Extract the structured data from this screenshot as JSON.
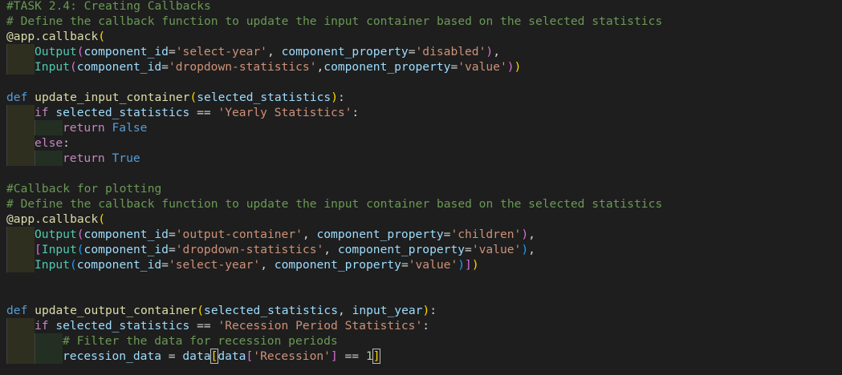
{
  "editor": {
    "lines": [
      {
        "indent": 0,
        "tokens": [
          {
            "t": "#TASK 2.4: Creating Callbacks",
            "c": "comment"
          }
        ]
      },
      {
        "indent": 0,
        "tokens": [
          {
            "t": "# Define the callback function to update the input container based on the selected statistics",
            "c": "comment"
          }
        ]
      },
      {
        "indent": 0,
        "tokens": [
          {
            "t": "@app.",
            "c": "func"
          },
          {
            "t": "callback",
            "c": "func"
          },
          {
            "t": "(",
            "c": "bracket1"
          }
        ]
      },
      {
        "indent": 1,
        "tokens": [
          {
            "t": "Output",
            "c": "cls"
          },
          {
            "t": "(",
            "c": "bracket2"
          },
          {
            "t": "component_id",
            "c": "param"
          },
          {
            "t": "=",
            "c": "op"
          },
          {
            "t": "'select-year'",
            "c": "str"
          },
          {
            "t": ", ",
            "c": "plain"
          },
          {
            "t": "component_property",
            "c": "param"
          },
          {
            "t": "=",
            "c": "op"
          },
          {
            "t": "'disabled'",
            "c": "str"
          },
          {
            "t": ")",
            "c": "bracket2"
          },
          {
            "t": ",",
            "c": "plain"
          }
        ]
      },
      {
        "indent": 1,
        "tokens": [
          {
            "t": "Input",
            "c": "cls"
          },
          {
            "t": "(",
            "c": "bracket2"
          },
          {
            "t": "component_id",
            "c": "param"
          },
          {
            "t": "=",
            "c": "op"
          },
          {
            "t": "'dropdown-statistics'",
            "c": "str"
          },
          {
            "t": ",",
            "c": "plain"
          },
          {
            "t": "component_property",
            "c": "param"
          },
          {
            "t": "=",
            "c": "op"
          },
          {
            "t": "'value'",
            "c": "str"
          },
          {
            "t": ")",
            "c": "bracket2"
          },
          {
            "t": ")",
            "c": "bracket1"
          }
        ]
      },
      {
        "indent": 0,
        "tokens": []
      },
      {
        "indent": 0,
        "tokens": [
          {
            "t": "def ",
            "c": "keyword"
          },
          {
            "t": "update_input_container",
            "c": "func"
          },
          {
            "t": "(",
            "c": "bracket1"
          },
          {
            "t": "selected_statistics",
            "c": "param"
          },
          {
            "t": ")",
            "c": "bracket1"
          },
          {
            "t": ":",
            "c": "plain"
          }
        ]
      },
      {
        "indent": 1,
        "tokens": [
          {
            "t": "if ",
            "c": "control"
          },
          {
            "t": "selected_statistics",
            "c": "param"
          },
          {
            "t": " == ",
            "c": "op"
          },
          {
            "t": "'Yearly Statistics'",
            "c": "str"
          },
          {
            "t": ":",
            "c": "plain"
          }
        ]
      },
      {
        "indent": 2,
        "tokens": [
          {
            "t": "return ",
            "c": "control"
          },
          {
            "t": "False",
            "c": "boolean"
          }
        ]
      },
      {
        "indent": 1,
        "tokens": [
          {
            "t": "else",
            "c": "control"
          },
          {
            "t": ":",
            "c": "plain"
          }
        ]
      },
      {
        "indent": 2,
        "tokens": [
          {
            "t": "return ",
            "c": "control"
          },
          {
            "t": "True",
            "c": "boolean"
          }
        ]
      },
      {
        "indent": 0,
        "tokens": []
      },
      {
        "indent": 0,
        "tokens": [
          {
            "t": "#Callback for plotting",
            "c": "comment"
          }
        ]
      },
      {
        "indent": 0,
        "tokens": [
          {
            "t": "# Define the callback function to update the input container based on the selected statistics",
            "c": "comment"
          }
        ]
      },
      {
        "indent": 0,
        "tokens": [
          {
            "t": "@app.",
            "c": "func"
          },
          {
            "t": "callback",
            "c": "func"
          },
          {
            "t": "(",
            "c": "bracket1"
          }
        ]
      },
      {
        "indent": 1,
        "tokens": [
          {
            "t": "Output",
            "c": "cls"
          },
          {
            "t": "(",
            "c": "bracket2"
          },
          {
            "t": "component_id",
            "c": "param"
          },
          {
            "t": "=",
            "c": "op"
          },
          {
            "t": "'output-container'",
            "c": "str"
          },
          {
            "t": ", ",
            "c": "plain"
          },
          {
            "t": "component_property",
            "c": "param"
          },
          {
            "t": "=",
            "c": "op"
          },
          {
            "t": "'children'",
            "c": "str"
          },
          {
            "t": ")",
            "c": "bracket2"
          },
          {
            "t": ",",
            "c": "plain"
          }
        ]
      },
      {
        "indent": 1,
        "tokens": [
          {
            "t": "[",
            "c": "bracket2"
          },
          {
            "t": "Input",
            "c": "cls"
          },
          {
            "t": "(",
            "c": "bracket3"
          },
          {
            "t": "component_id",
            "c": "param"
          },
          {
            "t": "=",
            "c": "op"
          },
          {
            "t": "'dropdown-statistics'",
            "c": "str"
          },
          {
            "t": ", ",
            "c": "plain"
          },
          {
            "t": "component_property",
            "c": "param"
          },
          {
            "t": "=",
            "c": "op"
          },
          {
            "t": "'value'",
            "c": "str"
          },
          {
            "t": ")",
            "c": "bracket3"
          },
          {
            "t": ",",
            "c": "plain"
          }
        ]
      },
      {
        "indent": 1,
        "tokens": [
          {
            "t": "Input",
            "c": "cls"
          },
          {
            "t": "(",
            "c": "bracket3"
          },
          {
            "t": "component_id",
            "c": "param"
          },
          {
            "t": "=",
            "c": "op"
          },
          {
            "t": "'select-year'",
            "c": "str"
          },
          {
            "t": ", ",
            "c": "plain"
          },
          {
            "t": "component_property",
            "c": "param"
          },
          {
            "t": "=",
            "c": "op"
          },
          {
            "t": "'value'",
            "c": "str"
          },
          {
            "t": ")",
            "c": "bracket3"
          },
          {
            "t": "]",
            "c": "bracket2"
          },
          {
            "t": ")",
            "c": "bracket1"
          }
        ]
      },
      {
        "indent": 0,
        "tokens": []
      },
      {
        "indent": 0,
        "tokens": []
      },
      {
        "indent": 0,
        "tokens": [
          {
            "t": "def ",
            "c": "keyword"
          },
          {
            "t": "update_output_container",
            "c": "func"
          },
          {
            "t": "(",
            "c": "bracket1"
          },
          {
            "t": "selected_statistics",
            "c": "param"
          },
          {
            "t": ", ",
            "c": "plain"
          },
          {
            "t": "input_year",
            "c": "param"
          },
          {
            "t": ")",
            "c": "bracket1"
          },
          {
            "t": ":",
            "c": "plain"
          }
        ]
      },
      {
        "indent": 1,
        "tokens": [
          {
            "t": "if ",
            "c": "control"
          },
          {
            "t": "selected_statistics",
            "c": "param"
          },
          {
            "t": " == ",
            "c": "op"
          },
          {
            "t": "'Recession Period Statistics'",
            "c": "str"
          },
          {
            "t": ":",
            "c": "plain"
          }
        ]
      },
      {
        "indent": 2,
        "tokens": [
          {
            "t": "# Filter the data for recession periods",
            "c": "comment"
          }
        ]
      },
      {
        "indent": 2,
        "tokens": [
          {
            "t": "recession_data",
            "c": "param"
          },
          {
            "t": " = ",
            "c": "op"
          },
          {
            "t": "data",
            "c": "param"
          },
          {
            "t": "[",
            "c": "bracket1",
            "box": true
          },
          {
            "t": "data",
            "c": "param"
          },
          {
            "t": "[",
            "c": "bracket2"
          },
          {
            "t": "'Recession'",
            "c": "str"
          },
          {
            "t": "]",
            "c": "bracket2"
          },
          {
            "t": " == ",
            "c": "op"
          },
          {
            "t": "1",
            "c": "num"
          },
          {
            "t": "]",
            "c": "bracket1",
            "box": true
          }
        ]
      }
    ]
  },
  "colors": {
    "background": "#1e1e1e",
    "comment": "#6a9955",
    "keyword": "#569cd6",
    "control": "#c586c0",
    "function": "#dcdcaa",
    "class": "#4ec9b0",
    "parameter": "#9cdcfe",
    "string": "#ce9178",
    "number": "#b5cea8"
  }
}
